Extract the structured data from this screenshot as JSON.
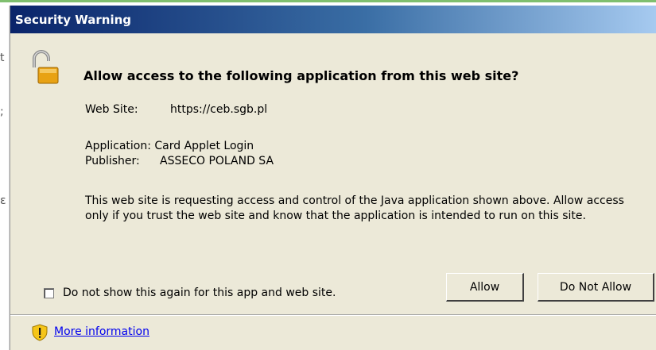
{
  "dialog": {
    "title": "Security Warning",
    "heading": "Allow access to the following application from this web site?",
    "website_label": "Web Site:",
    "website_value": "https://ceb.sgb.pl",
    "application_label": "Application:",
    "application_value": "Card Applet Login",
    "publisher_label": "Publisher:",
    "publisher_value": "ASSECO POLAND SA",
    "warning_text": "This web site is requesting access and control of the Java application shown above. Allow access only if you trust the web site and know that the application is intended to run on this site.",
    "checkbox_label": "Do not show this again for this app and web site.",
    "checkbox_checked": false,
    "allow_label": "Allow",
    "deny_label": "Do Not Allow",
    "more_info_label": "More information"
  },
  "icons": {
    "lock": "open-padlock-icon",
    "info": "shield-warning-icon"
  },
  "colors": {
    "titlebar_start": "#0a246a",
    "titlebar_end": "#a6caf0",
    "dialog_bg": "#ece9d8",
    "link": "#0000ee"
  }
}
